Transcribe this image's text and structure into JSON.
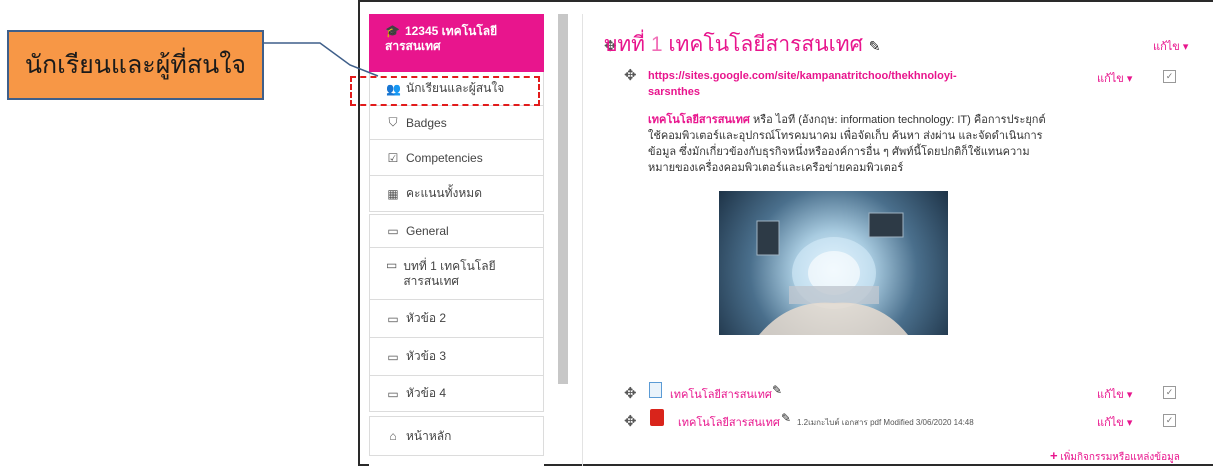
{
  "callout": {
    "label": "นักเรียนและผู้ที่สนใจ"
  },
  "nav": {
    "course": {
      "icon": "graduation-cap-icon",
      "label": "12345 เทคโนโลยีสารสนเทศ"
    },
    "items": [
      {
        "icon": "users-icon",
        "glyph": "👥",
        "label": "นักเรียนและผู้สนใจ"
      },
      {
        "icon": "shield-icon",
        "glyph": "⛉",
        "label": "Badges"
      },
      {
        "icon": "checkbox-icon",
        "glyph": "☑",
        "label": "Competencies"
      },
      {
        "icon": "table-icon",
        "glyph": "▦",
        "label": "คะแนนทั้งหมด"
      },
      {
        "icon": "folder-icon",
        "glyph": "▭",
        "label": "General"
      },
      {
        "icon": "folder-icon",
        "glyph": "▭",
        "label": "บทที่ 1 เทคโนโลยีสารสนเทศ"
      },
      {
        "icon": "folder-icon",
        "glyph": "▭",
        "label": "หัวข้อ 2"
      },
      {
        "icon": "folder-icon",
        "glyph": "▭",
        "label": "หัวข้อ 3"
      },
      {
        "icon": "folder-icon",
        "glyph": "▭",
        "label": "หัวข้อ 4"
      },
      {
        "icon": "home-icon",
        "glyph": "⌂",
        "label": "หน้าหลัก"
      }
    ]
  },
  "section": {
    "title_prefix": "บทที่ ",
    "title_num": "1",
    "title_rest": " เทคโนโลยีสารสนเทศ",
    "edit_label": "แก้ไข ▾"
  },
  "url_resource": {
    "link": "https://sites.google.com/site/kampanatritchoo/thekhnoloyi-sarsnthes",
    "edit_label": "แก้ไข ▾"
  },
  "description": {
    "term": "เทคโนโลยีสารสนเทศ",
    "text": " หรือ ไอที (อังกฤษ: information technology: IT) คือการประยุกต์ใช้คอมพิวเตอร์และอุปกรณ์โทรคมนาคม เพื่อจัดเก็บ ค้นหา ส่งผ่าน และจัดดำเนินการข้อมูล ซึ่งมักเกี่ยวข้องกับธุรกิจหนึ่งหรือองค์การอื่น ๆ ศัพท์นี้โดยปกติก็ใช้แทนความหมายของเครื่องคอมพิวเตอร์และเครือข่ายคอมพิวเตอร์"
  },
  "resources": [
    {
      "icon": "page-icon",
      "name": "เทคโนโลยีสารสนเทศ",
      "meta": "",
      "edit_label": "แก้ไข ▾"
    },
    {
      "icon": "pdf-icon",
      "name": "เทคโนโลยีสารสนเทศ",
      "meta": "1.2เมกะไบต์ เอกสาร pdf Modified 3/06/2020 14:48",
      "edit_label": "แก้ไข ▾"
    }
  ],
  "add_activity": {
    "label": "เพิ่มกิจกรรมหรือแหล่งข้อมูล"
  },
  "colors": {
    "brand": "#e8158d",
    "callout": "#f79746",
    "dash": "#e21b1b"
  }
}
